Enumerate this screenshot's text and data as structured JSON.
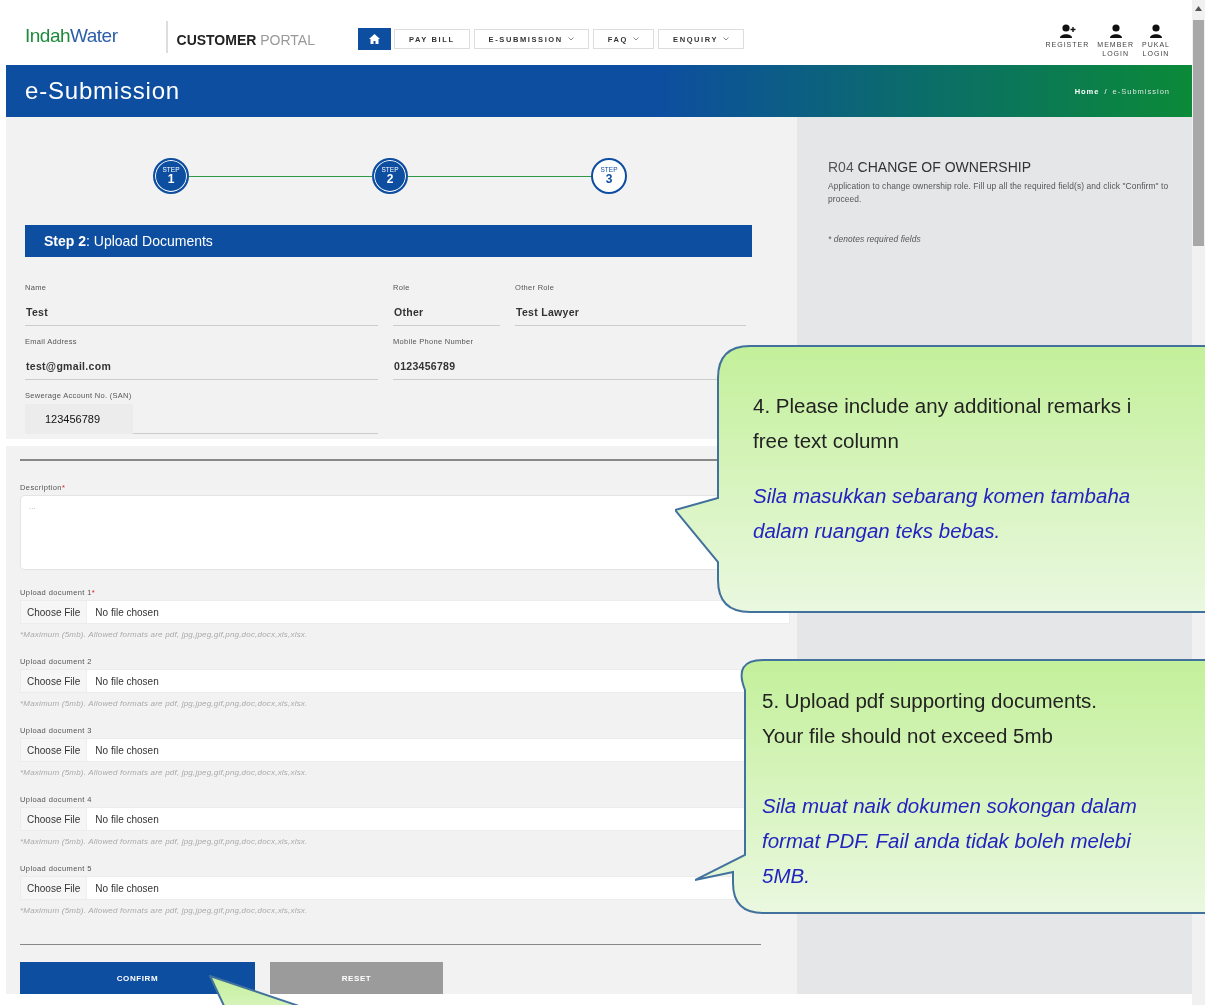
{
  "header": {
    "logo": {
      "brand_first": "Indah",
      "brand_second": "Water"
    },
    "portal": {
      "strong": "CUSTOMER",
      "light": "PORTAL"
    },
    "nav": [
      {
        "kind": "home",
        "selected": true
      },
      {
        "kind": "link",
        "label": "PAY BILL",
        "has_menu": false,
        "selected": false
      },
      {
        "kind": "link",
        "label": "E-SUBMISSION",
        "has_menu": true,
        "selected": false
      },
      {
        "kind": "link",
        "label": "FAQ",
        "has_menu": true,
        "selected": false
      },
      {
        "kind": "link",
        "label": "ENQUIRY",
        "has_menu": true,
        "selected": false
      }
    ],
    "user_links": [
      {
        "kind": "register",
        "lines": [
          "REGISTER"
        ]
      },
      {
        "kind": "member",
        "lines": [
          "MEMBER",
          "LOGIN"
        ]
      },
      {
        "kind": "member",
        "lines": [
          "PUKAL",
          "LOGIN"
        ]
      }
    ]
  },
  "banner": {
    "title": "e-Submission",
    "separator": "/",
    "breadcrumb": [
      {
        "label": "Home",
        "current": false
      },
      {
        "label": "e-Submission",
        "current": true
      }
    ]
  },
  "steps": [
    {
      "caption": "STEP",
      "number": "1",
      "completed": true
    },
    {
      "caption": "STEP",
      "number": "2",
      "completed": true
    },
    {
      "caption": "STEP",
      "number": "3",
      "completed": false
    }
  ],
  "step_header": {
    "step": "Step 2",
    "title": ": Upload Documents"
  },
  "required_symbol": "*",
  "fields": [
    [
      {
        "label": "Name",
        "value": "Test",
        "kind": "line"
      },
      {
        "label": "Role",
        "value": "Other",
        "kind": "line"
      },
      {
        "label": "Other Role",
        "value": "Test Lawyer",
        "kind": "line"
      }
    ],
    [
      {
        "label": "Email Address",
        "value": "test@gmail.com",
        "kind": "line"
      },
      {
        "label": "Mobile Phone Number",
        "value": "0123456789",
        "kind": "line"
      }
    ],
    [
      {
        "label": "Sewerage Account No. (SAN)",
        "value": "123456789",
        "kind": "boxed"
      }
    ]
  ],
  "description": {
    "label": "Description",
    "required": true,
    "placeholder": "..."
  },
  "uploads": [
    {
      "label": "Upload document 1",
      "required": true,
      "button": "Choose File",
      "status": "No file chosen",
      "hint": "*Maximum (5mb). Allowed formats are pdf, jpg,jpeg,gif,png,doc,docx,xls,xlsx."
    },
    {
      "label": "Upload document 2",
      "required": false,
      "button": "Choose File",
      "status": "No file chosen",
      "hint": "*Maximum (5mb). Allowed formats are pdf, jpg,jpeg,gif,png,doc,docx,xls,xlsx."
    },
    {
      "label": "Upload document 3",
      "required": false,
      "button": "Choose File",
      "status": "No file chosen",
      "hint": "*Maximum (5mb). Allowed formats are pdf, jpg,jpeg,gif,png,doc,docx,xls,xlsx."
    },
    {
      "label": "Upload document 4",
      "required": false,
      "button": "Choose File",
      "status": "No file chosen",
      "hint": "*Maximum (5mb). Allowed formats are pdf, jpg,jpeg,gif,png,doc,docx,xls,xlsx."
    },
    {
      "label": "Upload document 5",
      "required": false,
      "button": "Choose File",
      "status": "No file chosen",
      "hint": "*Maximum (5mb). Allowed formats are pdf, jpg,jpeg,gif,png,doc,docx,xls,xlsx."
    }
  ],
  "buttons": [
    {
      "label": "CONFIRM",
      "kind": "primary"
    },
    {
      "label": "RESET",
      "kind": "secondary"
    }
  ],
  "side": {
    "code": "R04",
    "title": "CHANGE OF OWNERSHIP",
    "text": "Application to change ownership role. Fill up all the required field(s) and click \"Confirm\" to proceed.",
    "note": "* denotes required fields"
  },
  "callouts": [
    {
      "kind": "bubble",
      "paragraphs": [
        {
          "italic": false,
          "lines": [
            "4. Please include any additional remarks i",
            "free text column"
          ]
        },
        {
          "italic": true,
          "lines": [
            "Sila masukkan sebarang komen tambaha",
            "dalam ruangan teks bebas."
          ]
        }
      ]
    },
    {
      "kind": "bubble",
      "paragraphs": [
        {
          "italic": false,
          "lines": [
            "5. Upload pdf supporting documents.",
            "Your file should not exceed 5mb"
          ]
        },
        {
          "italic": true,
          "lines": [
            "Sila muat naik dokumen sokongan dalam",
            "format PDF. Fail anda tidak boleh melebi",
            "5MB."
          ]
        }
      ]
    },
    {
      "kind": "pointer"
    }
  ]
}
